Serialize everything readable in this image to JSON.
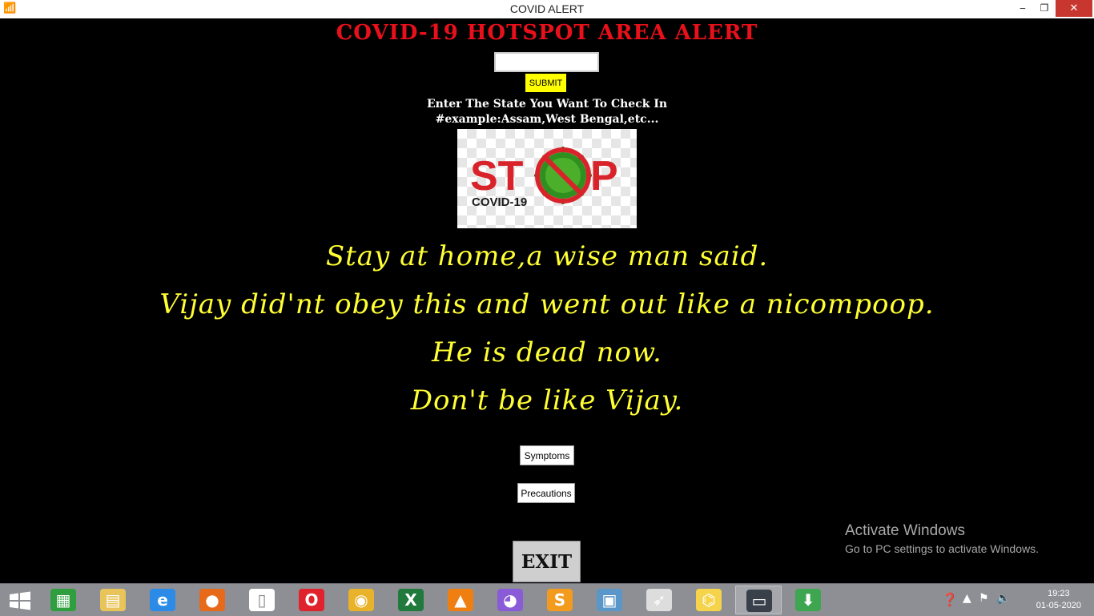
{
  "window": {
    "title": "COVID ALERT",
    "min_glyph": "‒",
    "max_glyph": "❐",
    "close_glyph": "✕"
  },
  "app": {
    "heading": "COVID-19 HOTSPOT AREA ALERT",
    "state_input_value": "",
    "submit_label": "SUBMIT",
    "instruction_line1": "Enter The State You Want To Check In",
    "instruction_line2": "#example:Assam,West Bengal,etc...",
    "stop_image": {
      "word_left": "ST",
      "word_right": "P",
      "subtitle": "COVID-19"
    },
    "quote_lines": [
      "Stay at home,a wise man said.",
      "Vijay did'nt obey this and went out like a nicompoop.",
      "He is dead now.",
      "Don't be like Vijay."
    ],
    "symptoms_label": "Symptoms",
    "precautions_label": "Precautions",
    "exit_label": "EXIT"
  },
  "watermark": {
    "line1": "Activate Windows",
    "line2": "Go to PC settings to activate Windows."
  },
  "taskbar": {
    "apps": [
      {
        "icon": "store-icon",
        "glyph": "▦",
        "color": "#2e9e3e"
      },
      {
        "icon": "file-explorer-icon",
        "glyph": "▤",
        "color": "#e8c45a"
      },
      {
        "icon": "internet-explorer-icon",
        "glyph": "e",
        "color": "#2b8be6"
      },
      {
        "icon": "firefox-icon",
        "glyph": "●",
        "color": "#e66a1a"
      },
      {
        "icon": "blank-document-icon",
        "glyph": "▯",
        "color": "#ffffff"
      },
      {
        "icon": "opera-icon",
        "glyph": "O",
        "color": "#e0222c"
      },
      {
        "icon": "chrome-icon",
        "glyph": "◉",
        "color": "#e8b22a"
      },
      {
        "icon": "excel-icon",
        "glyph": "X",
        "color": "#1f7a3c"
      },
      {
        "icon": "vlc-icon",
        "glyph": "▲",
        "color": "#f07f12"
      },
      {
        "icon": "cat-app-icon",
        "glyph": "◕",
        "color": "#8a5bd6"
      },
      {
        "icon": "sublime-text-icon",
        "glyph": "S",
        "color": "#f29b1f"
      },
      {
        "icon": "photos-icon",
        "glyph": "▣",
        "color": "#5a96c8"
      },
      {
        "icon": "rocket-app-icon",
        "glyph": "➶",
        "color": "#dddddd"
      },
      {
        "icon": "python-icon",
        "glyph": "⌬",
        "color": "#f5d44b"
      },
      {
        "icon": "terminal-icon",
        "glyph": "▭",
        "color": "#39404a"
      },
      {
        "icon": "download-icon",
        "glyph": "⬇",
        "color": "#3ea550"
      }
    ],
    "time": "19:23",
    "date": "01-05-2020"
  }
}
